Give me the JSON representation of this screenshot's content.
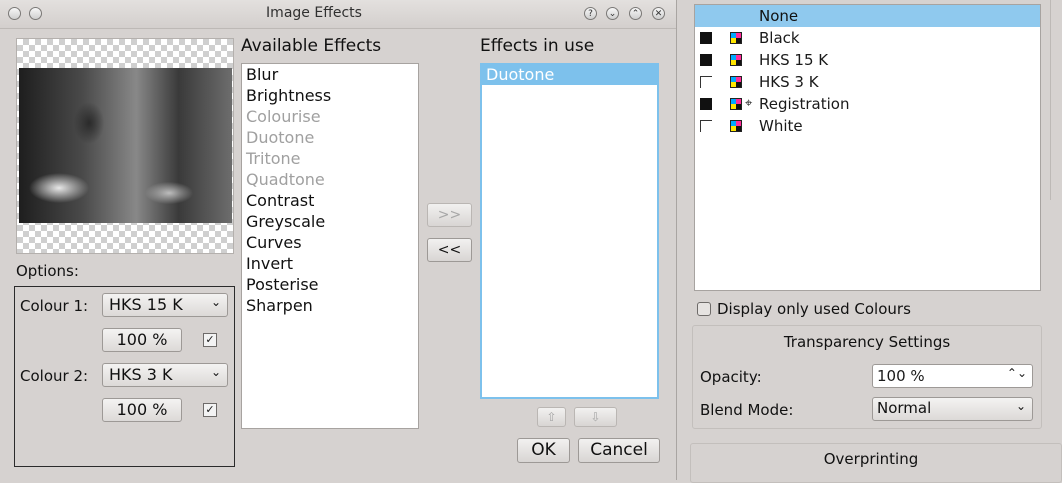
{
  "dialog": {
    "title": "Image Effects",
    "titlebar_buttons": [
      "?",
      "⌄",
      "⌃",
      "✕"
    ],
    "available_label": "Available Effects",
    "in_use_label": "Effects in use",
    "options_label": "Options:",
    "colour1_label": "Colour 1:",
    "colour1_value": "HKS 15 K",
    "colour1_shade": "100 %",
    "colour2_label": "Colour 2:",
    "colour2_value": "HKS 3 K",
    "colour2_shade": "100 %",
    "add_button": ">>",
    "remove_button": "<<",
    "ok_button": "OK",
    "cancel_button": "Cancel",
    "available_effects": [
      {
        "label": "Blur",
        "enabled": true
      },
      {
        "label": "Brightness",
        "enabled": true
      },
      {
        "label": "Colourise",
        "enabled": false
      },
      {
        "label": "Duotone",
        "enabled": false
      },
      {
        "label": "Tritone",
        "enabled": false
      },
      {
        "label": "Quadtone",
        "enabled": false
      },
      {
        "label": "Contrast",
        "enabled": true
      },
      {
        "label": "Greyscale",
        "enabled": true
      },
      {
        "label": "Curves",
        "enabled": true
      },
      {
        "label": "Invert",
        "enabled": true
      },
      {
        "label": "Posterise",
        "enabled": true
      },
      {
        "label": "Sharpen",
        "enabled": true
      }
    ],
    "effects_in_use": [
      {
        "label": "Duotone",
        "selected": true
      }
    ]
  },
  "colours_panel": {
    "items": [
      {
        "name": "None",
        "swatch": "none",
        "selected": true
      },
      {
        "name": "Black",
        "swatch": "solid",
        "selected": false
      },
      {
        "name": "HKS 15 K",
        "swatch": "solid",
        "selected": false
      },
      {
        "name": "HKS 3 K",
        "swatch": "corner",
        "selected": false
      },
      {
        "name": "Registration",
        "swatch": "solid",
        "selected": false,
        "registration": true
      },
      {
        "name": "White",
        "swatch": "corner",
        "selected": false
      }
    ],
    "display_only_used": "Display only used Colours",
    "transparency_title": "Transparency Settings",
    "opacity_label": "Opacity:",
    "opacity_value": "100 %",
    "blend_label": "Blend Mode:",
    "blend_value": "Normal",
    "overprinting_title": "Overprinting"
  }
}
